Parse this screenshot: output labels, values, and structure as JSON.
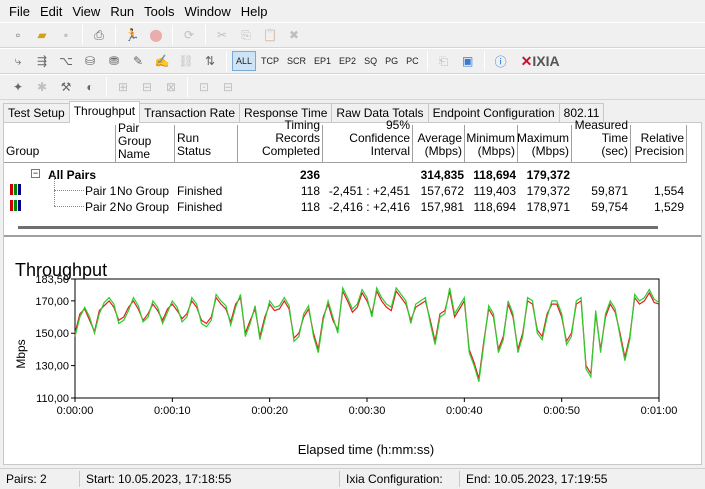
{
  "menu": [
    "File",
    "Edit",
    "View",
    "Run",
    "Tools",
    "Window",
    "Help"
  ],
  "toolbar": {
    "filters": [
      "ALL",
      "TCP",
      "SCR",
      "EP1",
      "EP2",
      "SQ",
      "PG",
      "PC"
    ],
    "logo": "IXIA"
  },
  "tabs": [
    "Test Setup",
    "Throughput",
    "Transaction Rate",
    "Response Time",
    "Raw Data Totals",
    "Endpoint Configuration",
    "802.11"
  ],
  "table": {
    "headers": {
      "group": "Group",
      "pair_group_name": "Pair Group Name",
      "run_status": "Run Status",
      "timing_records": "Timing Records Completed",
      "confidence": "95% Confidence Interval",
      "average": "Average (Mbps)",
      "minimum": "Minimum (Mbps)",
      "maximum": "Maximum (Mbps)",
      "measured_time": "Measured Time (sec)",
      "relative_precision": "Relative Precision"
    },
    "summary": {
      "label": "All Pairs",
      "timing": "236",
      "average": "314,835",
      "minimum": "118,694",
      "maximum": "179,372"
    },
    "rows": [
      {
        "pair": "Pair 1",
        "group": "No Group",
        "status": "Finished",
        "timing": "118",
        "confidence": "-2,451 : +2,451",
        "average": "157,672",
        "minimum": "119,403",
        "maximum": "179,372",
        "time": "59,871",
        "precision": "1,554"
      },
      {
        "pair": "Pair 2",
        "group": "No Group",
        "status": "Finished",
        "timing": "118",
        "confidence": "-2,416 : +2,416",
        "average": "157,981",
        "minimum": "118,694",
        "maximum": "178,971",
        "time": "59,754",
        "precision": "1,529"
      }
    ]
  },
  "chart_data": {
    "type": "line",
    "title": "Throughput",
    "xlabel": "Elapsed time (h:mm:ss)",
    "ylabel": "Mbps",
    "ylim": [
      110.0,
      183.5
    ],
    "xlim": [
      0,
      60
    ],
    "yticks": [
      "110,00",
      "130,00",
      "150,00",
      "170,00",
      "183,50"
    ],
    "ytick_values": [
      110,
      130,
      150,
      170,
      183.5
    ],
    "xticks": [
      "0:00:00",
      "0:00:10",
      "0:00:20",
      "0:00:30",
      "0:00:40",
      "0:00:50",
      "0:01:00"
    ],
    "xtick_values": [
      0,
      10,
      20,
      30,
      40,
      50,
      60
    ],
    "colors": {
      "pair1": "#e02020",
      "pair2": "#2ecc2e"
    },
    "series": [
      {
        "name": "Pair 1",
        "color": "#e02020",
        "x": [
          0,
          0.5,
          1,
          1.5,
          2,
          2.5,
          3,
          3.5,
          4,
          4.5,
          5,
          5.5,
          6,
          6.5,
          7,
          7.5,
          8,
          8.5,
          9,
          9.5,
          10,
          10.5,
          11,
          11.5,
          12,
          12.5,
          13,
          13.5,
          14,
          14.5,
          15,
          15.5,
          16,
          16.5,
          17,
          17.5,
          18,
          18.5,
          19,
          19.5,
          20,
          20.5,
          21,
          21.5,
          22,
          22.5,
          23,
          23.5,
          24,
          24.5,
          25,
          25.5,
          26,
          26.5,
          27,
          27.5,
          28,
          28.5,
          29,
          29.5,
          30,
          30.5,
          31,
          31.5,
          32,
          32.5,
          33,
          33.5,
          34,
          34.5,
          35,
          35.5,
          36,
          36.5,
          37,
          37.5,
          38,
          38.5,
          39,
          39.5,
          40,
          40.5,
          41,
          41.5,
          42,
          42.5,
          43,
          43.5,
          44,
          44.5,
          45,
          45.5,
          46,
          46.5,
          47,
          47.5,
          48,
          48.5,
          49,
          49.5,
          50,
          50.5,
          51,
          51.5,
          52,
          52.5,
          53,
          53.5,
          54,
          54.5,
          55,
          55.5,
          56,
          56.5,
          57,
          57.5,
          58,
          58.5,
          59,
          59.5,
          60
        ],
        "values": [
          150,
          162,
          165,
          158,
          151,
          164,
          167,
          170,
          166,
          158,
          160,
          166,
          170,
          165,
          158,
          162,
          168,
          164,
          158,
          165,
          168,
          164,
          159,
          162,
          170,
          166,
          158,
          156,
          160,
          172,
          168,
          165,
          157,
          168,
          172,
          150,
          158,
          165,
          148,
          160,
          168,
          164,
          165,
          170,
          165,
          147,
          150,
          160,
          165,
          150,
          140,
          160,
          168,
          158,
          152,
          176,
          170,
          163,
          166,
          175,
          170,
          162,
          176,
          170,
          166,
          164,
          176,
          172,
          168,
          158,
          166,
          168,
          170,
          158,
          145,
          162,
          164,
          176,
          160,
          165,
          170,
          140,
          132,
          122,
          145,
          165,
          160,
          140,
          148,
          168,
          160,
          140,
          150,
          170,
          168,
          152,
          148,
          162,
          168,
          168,
          160,
          145,
          150,
          168,
          170,
          130,
          125,
          162,
          140,
          160,
          168,
          163,
          150,
          135,
          148,
          172,
          168,
          170,
          175,
          169,
          168
        ]
      },
      {
        "name": "Pair 2",
        "color": "#2ecc2e",
        "x": [
          0,
          0.5,
          1,
          1.5,
          2,
          2.5,
          3,
          3.5,
          4,
          4.5,
          5,
          5.5,
          6,
          6.5,
          7,
          7.5,
          8,
          8.5,
          9,
          9.5,
          10,
          10.5,
          11,
          11.5,
          12,
          12.5,
          13,
          13.5,
          14,
          14.5,
          15,
          15.5,
          16,
          16.5,
          17,
          17.5,
          18,
          18.5,
          19,
          19.5,
          20,
          20.5,
          21,
          21.5,
          22,
          22.5,
          23,
          23.5,
          24,
          24.5,
          25,
          25.5,
          26,
          26.5,
          27,
          27.5,
          28,
          28.5,
          29,
          29.5,
          30,
          30.5,
          31,
          31.5,
          32,
          32.5,
          33,
          33.5,
          34,
          34.5,
          35,
          35.5,
          36,
          36.5,
          37,
          37.5,
          38,
          38.5,
          39,
          39.5,
          40,
          40.5,
          41,
          41.5,
          42,
          42.5,
          43,
          43.5,
          44,
          44.5,
          45,
          45.5,
          46,
          46.5,
          47,
          47.5,
          48,
          48.5,
          49,
          49.5,
          50,
          50.5,
          51,
          51.5,
          52,
          52.5,
          53,
          53.5,
          54,
          54.5,
          55,
          55.5,
          56,
          56.5,
          57,
          57.5,
          58,
          58.5,
          59,
          59.5,
          60
        ],
        "values": [
          148,
          160,
          166,
          160,
          150,
          162,
          169,
          172,
          168,
          156,
          158,
          164,
          172,
          167,
          157,
          160,
          170,
          166,
          156,
          163,
          170,
          166,
          157,
          160,
          172,
          168,
          156,
          154,
          158,
          174,
          170,
          167,
          155,
          166,
          174,
          148,
          156,
          167,
          146,
          158,
          170,
          166,
          167,
          172,
          167,
          145,
          148,
          162,
          167,
          148,
          138,
          158,
          170,
          160,
          150,
          178,
          172,
          165,
          168,
          177,
          172,
          160,
          178,
          172,
          168,
          166,
          178,
          174,
          170,
          156,
          168,
          170,
          172,
          156,
          143,
          160,
          162,
          178,
          162,
          167,
          172,
          138,
          130,
          120,
          143,
          167,
          162,
          138,
          146,
          170,
          162,
          138,
          148,
          172,
          170,
          150,
          146,
          160,
          170,
          170,
          162,
          143,
          148,
          170,
          172,
          128,
          123,
          164,
          138,
          162,
          170,
          165,
          148,
          133,
          146,
          174,
          170,
          172,
          177,
          171,
          169
        ]
      }
    ]
  },
  "status": {
    "pairs": "Pairs: 2",
    "start": "Start: 10.05.2023, 17:18:55",
    "config": "Ixia Configuration:",
    "end": "End: 10.05.2023, 17:19:55"
  }
}
